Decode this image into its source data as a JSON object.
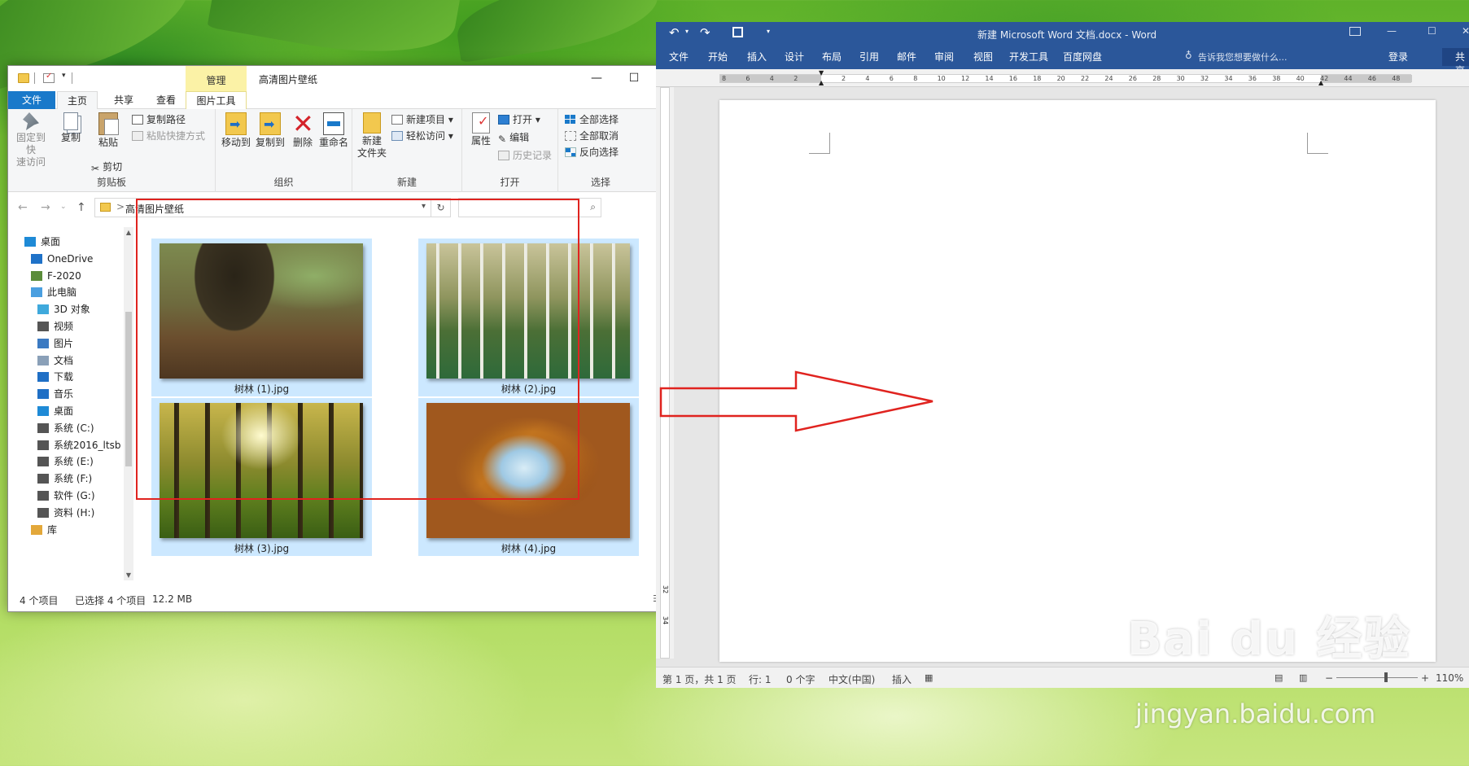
{
  "explorer": {
    "context_tab": "管理",
    "window_title": "高清图片壁纸",
    "controls": {
      "minimize": "—",
      "maximize": "☐",
      "close": "✕"
    },
    "tabs": [
      "文件",
      "主页",
      "共享",
      "查看",
      "图片工具"
    ],
    "ribbon": {
      "clipboard": {
        "pin_label_line1": "固定到快",
        "pin_label_line2": "速访问",
        "copy": "复制",
        "paste": "粘贴",
        "copy_path": "复制路径",
        "paste_shortcut": "粘贴快捷方式",
        "cut": "剪切",
        "group": "剪贴板"
      },
      "organize": {
        "move_to": "移动到",
        "copy_to": "复制到",
        "delete": "删除",
        "rename": "重命名",
        "group": "组织"
      },
      "new": {
        "new_folder_line1": "新建",
        "new_folder_line2": "文件夹",
        "new_item": "新建项目",
        "easy_access": "轻松访问",
        "group": "新建"
      },
      "open": {
        "properties": "属性",
        "open": "打开",
        "edit": "编辑",
        "history": "历史记录",
        "group": "打开"
      },
      "select": {
        "select_all": "全部选择",
        "select_none": "全部取消",
        "invert": "反向选择",
        "group": "选择"
      }
    },
    "address": {
      "path": "高清图片壁纸",
      "separator": ">"
    },
    "search_placeholder": "",
    "nav_items": [
      {
        "label": "桌面",
        "icon": "desktop-icon"
      },
      {
        "label": "OneDrive",
        "icon": "cloud-icon"
      },
      {
        "label": "F-2020",
        "icon": "user-icon"
      },
      {
        "label": "此电脑",
        "icon": "computer-icon"
      },
      {
        "label": "3D 对象",
        "icon": "cube-icon"
      },
      {
        "label": "视频",
        "icon": "video-icon"
      },
      {
        "label": "图片",
        "icon": "picture-icon"
      },
      {
        "label": "文档",
        "icon": "document-icon"
      },
      {
        "label": "下载",
        "icon": "download-icon"
      },
      {
        "label": "音乐",
        "icon": "music-icon"
      },
      {
        "label": "桌面",
        "icon": "desktop-icon"
      },
      {
        "label": "系统 (C:)",
        "icon": "windows-drive-icon"
      },
      {
        "label": "系统2016_ltsb",
        "icon": "drive-icon"
      },
      {
        "label": "系统 (E:)",
        "icon": "drive-icon"
      },
      {
        "label": "系统 (F:)",
        "icon": "drive-icon"
      },
      {
        "label": "软件 (G:)",
        "icon": "drive-icon"
      },
      {
        "label": "资料 (H:)",
        "icon": "drive-icon"
      },
      {
        "label": "库",
        "icon": "library-icon"
      }
    ],
    "files": [
      {
        "name": "树林 (1).jpg"
      },
      {
        "name": "树林 (2).jpg"
      },
      {
        "name": "树林 (3).jpg"
      },
      {
        "name": "树林 (4).jpg"
      }
    ],
    "status": {
      "count": "4 个项目",
      "selected": "已选择 4 个项目",
      "size": "12.2 MB"
    }
  },
  "word": {
    "title": "新建 Microsoft Word 文档.docx - Word",
    "tabs": [
      "文件",
      "开始",
      "插入",
      "设计",
      "布局",
      "引用",
      "邮件",
      "审阅",
      "视图",
      "开发工具",
      "百度网盘"
    ],
    "tell_me": "告诉我您想要做什么...",
    "login": "登录",
    "share": "共享",
    "ruler_ticks": [
      "8",
      "6",
      "4",
      "2",
      "",
      "2",
      "4",
      "6",
      "8",
      "10",
      "12",
      "14",
      "16",
      "18",
      "20",
      "22",
      "24",
      "26",
      "28",
      "30",
      "32",
      "34",
      "36",
      "38",
      "40",
      "42",
      "44",
      "46",
      "48"
    ],
    "vruler_ticks": [
      "32",
      "34"
    ],
    "status": {
      "page": "第 1 页，共 1 页",
      "line": "行: 1",
      "words": "0 个字",
      "language": "中文(中国)",
      "mode": "插入",
      "zoom": "110%"
    }
  },
  "watermark": {
    "brand": "Bai du 经验",
    "url": "jingyan.baidu.com"
  },
  "colors": {
    "word_blue": "#2b579a",
    "selection": "#cce8ff",
    "annotation_red": "#e0231f",
    "file_tab": "#1979ca"
  }
}
